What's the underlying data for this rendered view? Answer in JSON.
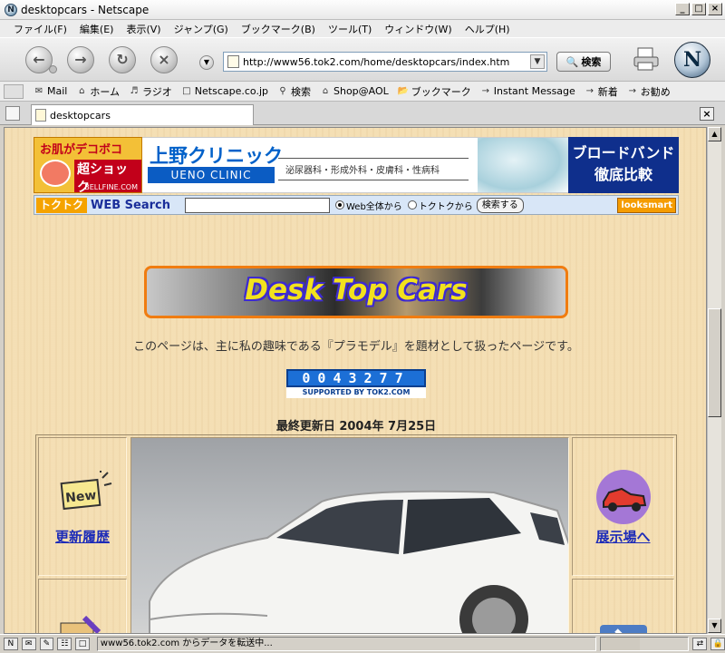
{
  "window": {
    "title": "desktopcars - Netscape",
    "minimize_glyph": "_",
    "maximize_glyph": "□",
    "close_glyph": "×"
  },
  "menu": [
    "ファイル(F)",
    "編集(E)",
    "表示(V)",
    "ジャンプ(G)",
    "ブックマーク(B)",
    "ツール(T)",
    "ウィンドウ(W)",
    "ヘルプ(H)"
  ],
  "navigation": {
    "url": "http://www56.tok2.com/home/desktopcars/index.htm",
    "search_button": "検索"
  },
  "personal_toolbar": [
    {
      "label": "Mail",
      "icon": "mail-icon"
    },
    {
      "label": "ホーム",
      "icon": "home-icon"
    },
    {
      "label": "ラジオ",
      "icon": "radio-icon"
    },
    {
      "label": "Netscape.co.jp",
      "icon": "my-icon"
    },
    {
      "label": "検索",
      "icon": "search-icon"
    },
    {
      "label": "Shop@AOL",
      "icon": "shop-icon"
    },
    {
      "label": "ブックマーク",
      "icon": "bookmark-icon"
    },
    {
      "label": "Instant Message",
      "icon": "im-icon"
    },
    {
      "label": "新着",
      "icon": "new-icon"
    },
    {
      "label": "お勧め",
      "icon": "recommend-icon"
    }
  ],
  "tab": {
    "label": "desktopcars"
  },
  "page": {
    "ads": {
      "skin_top": "お肌がデコボコ",
      "skin_mid": "超ショック",
      "skin_url": "BELLFINE.COM",
      "clinic_name": "上野クリニック",
      "clinic_en": "UENO CLINIC",
      "clinic_depts": "泌尿器科・形成外科・皮膚科・性病科",
      "broadband_line1": "ブロードバンド",
      "broadband_line2": "徹底比較"
    },
    "search": {
      "logo": "トクトク",
      "label": "WEB Search",
      "radio_web": "Web全体から",
      "radio_site": "トクトクから",
      "submit": "検索する",
      "looksmart": "looksmart"
    },
    "logo_text": "Desk Top Cars",
    "intro": "このページは、主に私の趣味である『プラモデル』を題材として扱ったページです。",
    "counter": {
      "digits": "0043277",
      "supported": "SUPPORTED BY TOK2.COM"
    },
    "updated": "最終更新日 2004年 7月25日",
    "links": {
      "history": "更新履歴",
      "showroom": "展示場へ",
      "new_badge": "New"
    }
  },
  "status": {
    "text": "www56.tok2.com からデータを転送中..."
  }
}
